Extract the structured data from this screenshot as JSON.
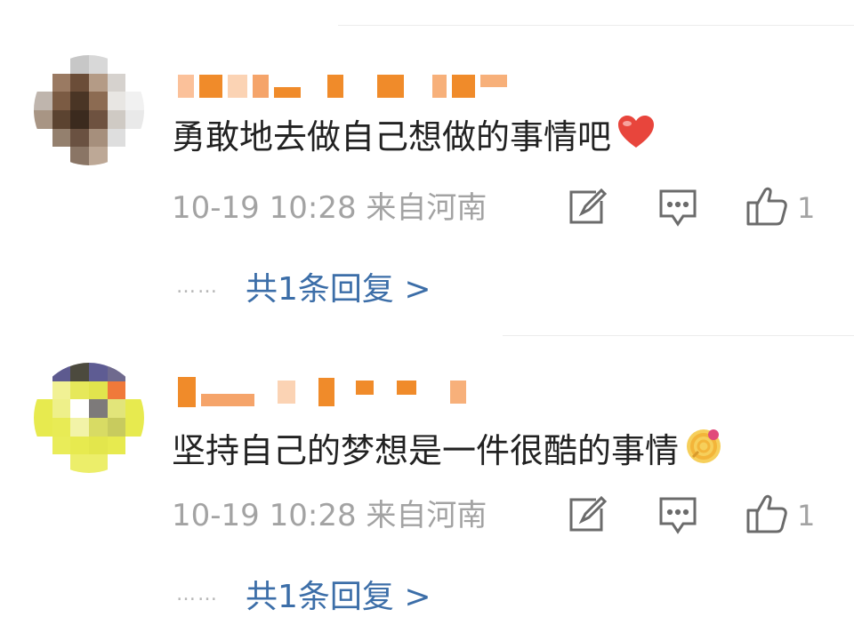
{
  "comments": [
    {
      "text": "勇敢地去做自己想做的事情吧",
      "emoji": "heart",
      "time": "10-19 10:28 来自河南",
      "likes": "1",
      "dots": "……",
      "reply_link": "共1条回复 >",
      "colors": {
        "username": "#f08b2a",
        "avatar": "#8b6f57"
      }
    },
    {
      "text": "坚持自己的梦想是一件很酷的事情",
      "emoji": "lollipop",
      "time": "10-19 10:28 来自河南",
      "likes": "1",
      "dots": "……",
      "reply_link": "共1条回复 >",
      "colors": {
        "username": "#f08b2a",
        "avatar": "#e7ea4f"
      }
    }
  ],
  "icons": [
    "repost-icon",
    "comment-icon",
    "like-icon"
  ],
  "colors": {
    "link": "#3c6ea8",
    "meta": "#a3a3a3",
    "text": "#222222"
  }
}
